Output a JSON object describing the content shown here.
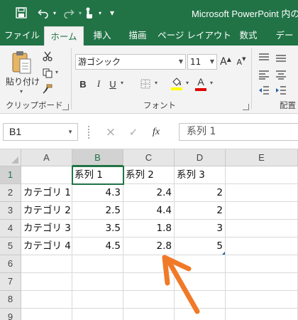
{
  "app": {
    "title": "Microsoft PowerPoint 内の",
    "accent_color": "#217346"
  },
  "qat": {
    "save_icon": "save-icon",
    "undo_icon": "undo-icon",
    "redo_icon": "redo-icon",
    "touch_icon": "touch-mode-icon",
    "customize_icon": "customize-qat-icon"
  },
  "tabs": [
    {
      "label": "ファイル",
      "active": false
    },
    {
      "label": "ホーム",
      "active": true
    },
    {
      "label": "挿入",
      "active": false
    },
    {
      "label": "描画",
      "active": false
    },
    {
      "label": "ページ レイアウト",
      "active": false
    },
    {
      "label": "数式",
      "active": false
    },
    {
      "label": "デー",
      "active": false
    }
  ],
  "ribbon": {
    "clipboard": {
      "label": "クリップボード",
      "paste_label": "貼り付け",
      "cut_icon": "scissors-icon",
      "copy_icon": "copy-icon",
      "format_painter_icon": "format-painter-icon"
    },
    "font": {
      "label": "フォント",
      "font_name": "游ゴシック",
      "font_size": "11",
      "grow_label": "A",
      "shrink_label": "A",
      "bold_label": "B",
      "italic_label": "I",
      "underline_label": "U",
      "font_color_label": "A",
      "highlight_color": "#ffff00",
      "font_color": "#e00000"
    },
    "alignment": {
      "label": "配置"
    }
  },
  "formula_bar": {
    "name_box": "B1",
    "cancel_label": "×",
    "enter_label": "✓",
    "fx_label": "fx",
    "formula_value": "系列 1"
  },
  "sheet": {
    "columns": [
      "A",
      "B",
      "C",
      "D",
      "E"
    ],
    "rows": [
      "1",
      "2",
      "3",
      "4",
      "5",
      "6",
      "7",
      "8",
      "9"
    ],
    "selected_column": "B",
    "selected_row": "1",
    "cells": [
      [
        "",
        "系列 1",
        "系列 2",
        "系列 3",
        ""
      ],
      [
        "カテゴリ 1",
        "4.3",
        "2.4",
        "2",
        ""
      ],
      [
        "カテゴリ 2",
        "2.5",
        "4.4",
        "2",
        ""
      ],
      [
        "カテゴリ 3",
        "3.5",
        "1.8",
        "3",
        ""
      ],
      [
        "カテゴリ 4",
        "4.5",
        "2.8",
        "5",
        ""
      ],
      [
        "",
        "",
        "",
        "",
        ""
      ],
      [
        "",
        "",
        "",
        "",
        ""
      ],
      [
        "",
        "",
        "",
        "",
        ""
      ],
      [
        "",
        "",
        "",
        "",
        ""
      ]
    ]
  },
  "annotation": {
    "arrow_color": "#f07a28",
    "arrow_icon": "pointer-arrow"
  }
}
